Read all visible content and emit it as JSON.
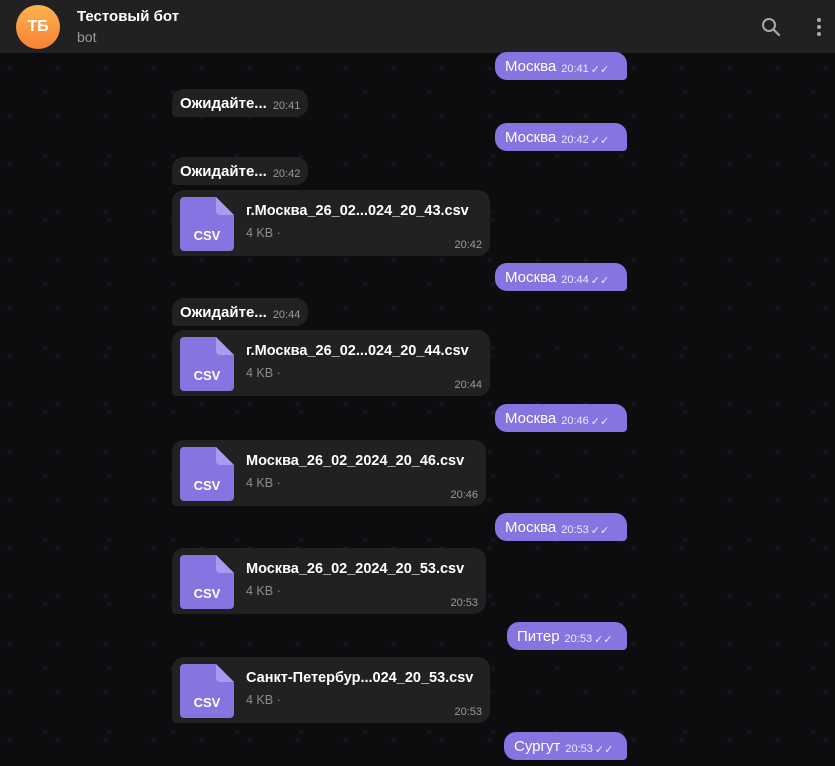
{
  "header": {
    "avatar_initials": "ТБ",
    "title": "Тестовый бот",
    "subtitle": "bot",
    "icons": [
      "search-icon",
      "more-vertical-icon"
    ]
  },
  "colors": {
    "outgoing_bubble": "#8774e1",
    "incoming_bubble": "#212121",
    "avatar": "#f68136",
    "file_icon": "#8774e1"
  },
  "messages": [
    {
      "type": "out",
      "text": "Москва",
      "time": "20:41"
    },
    {
      "type": "in",
      "text": "Ожидайте...",
      "time": "20:41"
    },
    {
      "type": "out",
      "text": "Москва",
      "time": "20:42"
    },
    {
      "type": "in",
      "text": "Ожидайте...",
      "time": "20:42"
    },
    {
      "type": "file",
      "ext": "CSV",
      "name": "г.Москва_26_02...024_20_43.csv",
      "size": "4 KB ·",
      "time": "20:42"
    },
    {
      "type": "out",
      "text": "Москва",
      "time": "20:44"
    },
    {
      "type": "in",
      "text": "Ожидайте...",
      "time": "20:44"
    },
    {
      "type": "file",
      "ext": "CSV",
      "name": "г.Москва_26_02...024_20_44.csv",
      "size": "4 KB ·",
      "time": "20:44"
    },
    {
      "type": "out",
      "text": "Москва",
      "time": "20:46"
    },
    {
      "type": "file",
      "ext": "CSV",
      "name": "Москва_26_02_2024_20_46.csv",
      "size": "4 KB ·",
      "time": "20:46"
    },
    {
      "type": "out",
      "text": "Москва",
      "time": "20:53"
    },
    {
      "type": "file",
      "ext": "CSV",
      "name": "Москва_26_02_2024_20_53.csv",
      "size": "4 KB ·",
      "time": "20:53"
    },
    {
      "type": "out",
      "text": "Питер",
      "time": "20:53"
    },
    {
      "type": "file",
      "ext": "CSV",
      "name": "Санкт-Петербур...024_20_53.csv",
      "size": "4 KB ·",
      "time": "20:53"
    },
    {
      "type": "out",
      "text": "Сургут",
      "time": "20:53"
    }
  ]
}
